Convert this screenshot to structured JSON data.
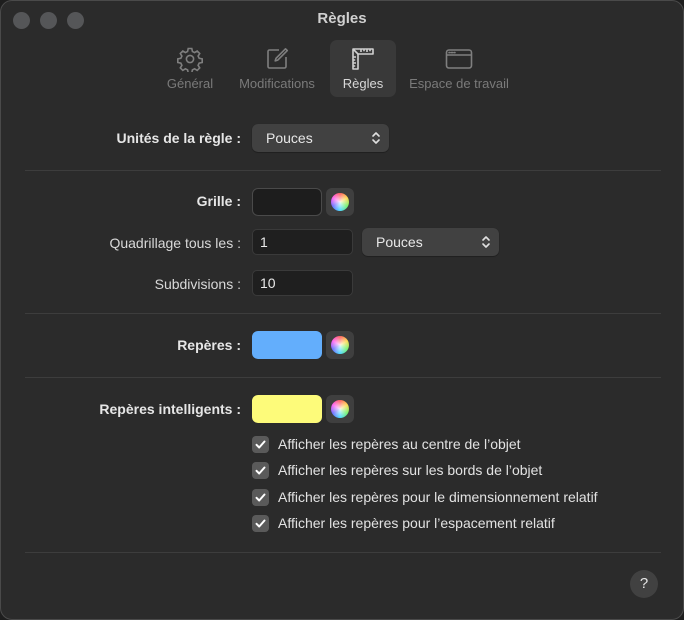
{
  "window": {
    "title": "Règles"
  },
  "toolbar": {
    "tabs": [
      {
        "label": "Général",
        "icon": "gear-icon",
        "selected": false
      },
      {
        "label": "Modifications",
        "icon": "edit-icon",
        "selected": false
      },
      {
        "label": "Règles",
        "icon": "ruler-icon",
        "selected": true
      },
      {
        "label": "Espace de travail",
        "icon": "window-icon",
        "selected": false
      }
    ]
  },
  "units": {
    "label": "Unités de la règle :",
    "value": "Pouces"
  },
  "grid": {
    "label": "Grille :",
    "color": "#1d1d1d",
    "spacing_label": "Quadrillage tous les :",
    "spacing_value": "1",
    "spacing_units": "Pouces",
    "subdivisions_label": "Subdivisions :",
    "subdivisions_value": "10"
  },
  "guides": {
    "label": "Repères :",
    "color": "#63aefc"
  },
  "smart_guides": {
    "label": "Repères intelligents :",
    "color": "#fdfb7a",
    "options": [
      {
        "label": "Afficher les repères au centre de l’objet",
        "checked": true
      },
      {
        "label": "Afficher les repères sur les bords de l’objet",
        "checked": true
      },
      {
        "label": "Afficher les repères pour le dimensionnement relatif",
        "checked": true
      },
      {
        "label": "Afficher les repères pour l’espacement relatif",
        "checked": true
      }
    ]
  },
  "help": {
    "label": "?"
  }
}
